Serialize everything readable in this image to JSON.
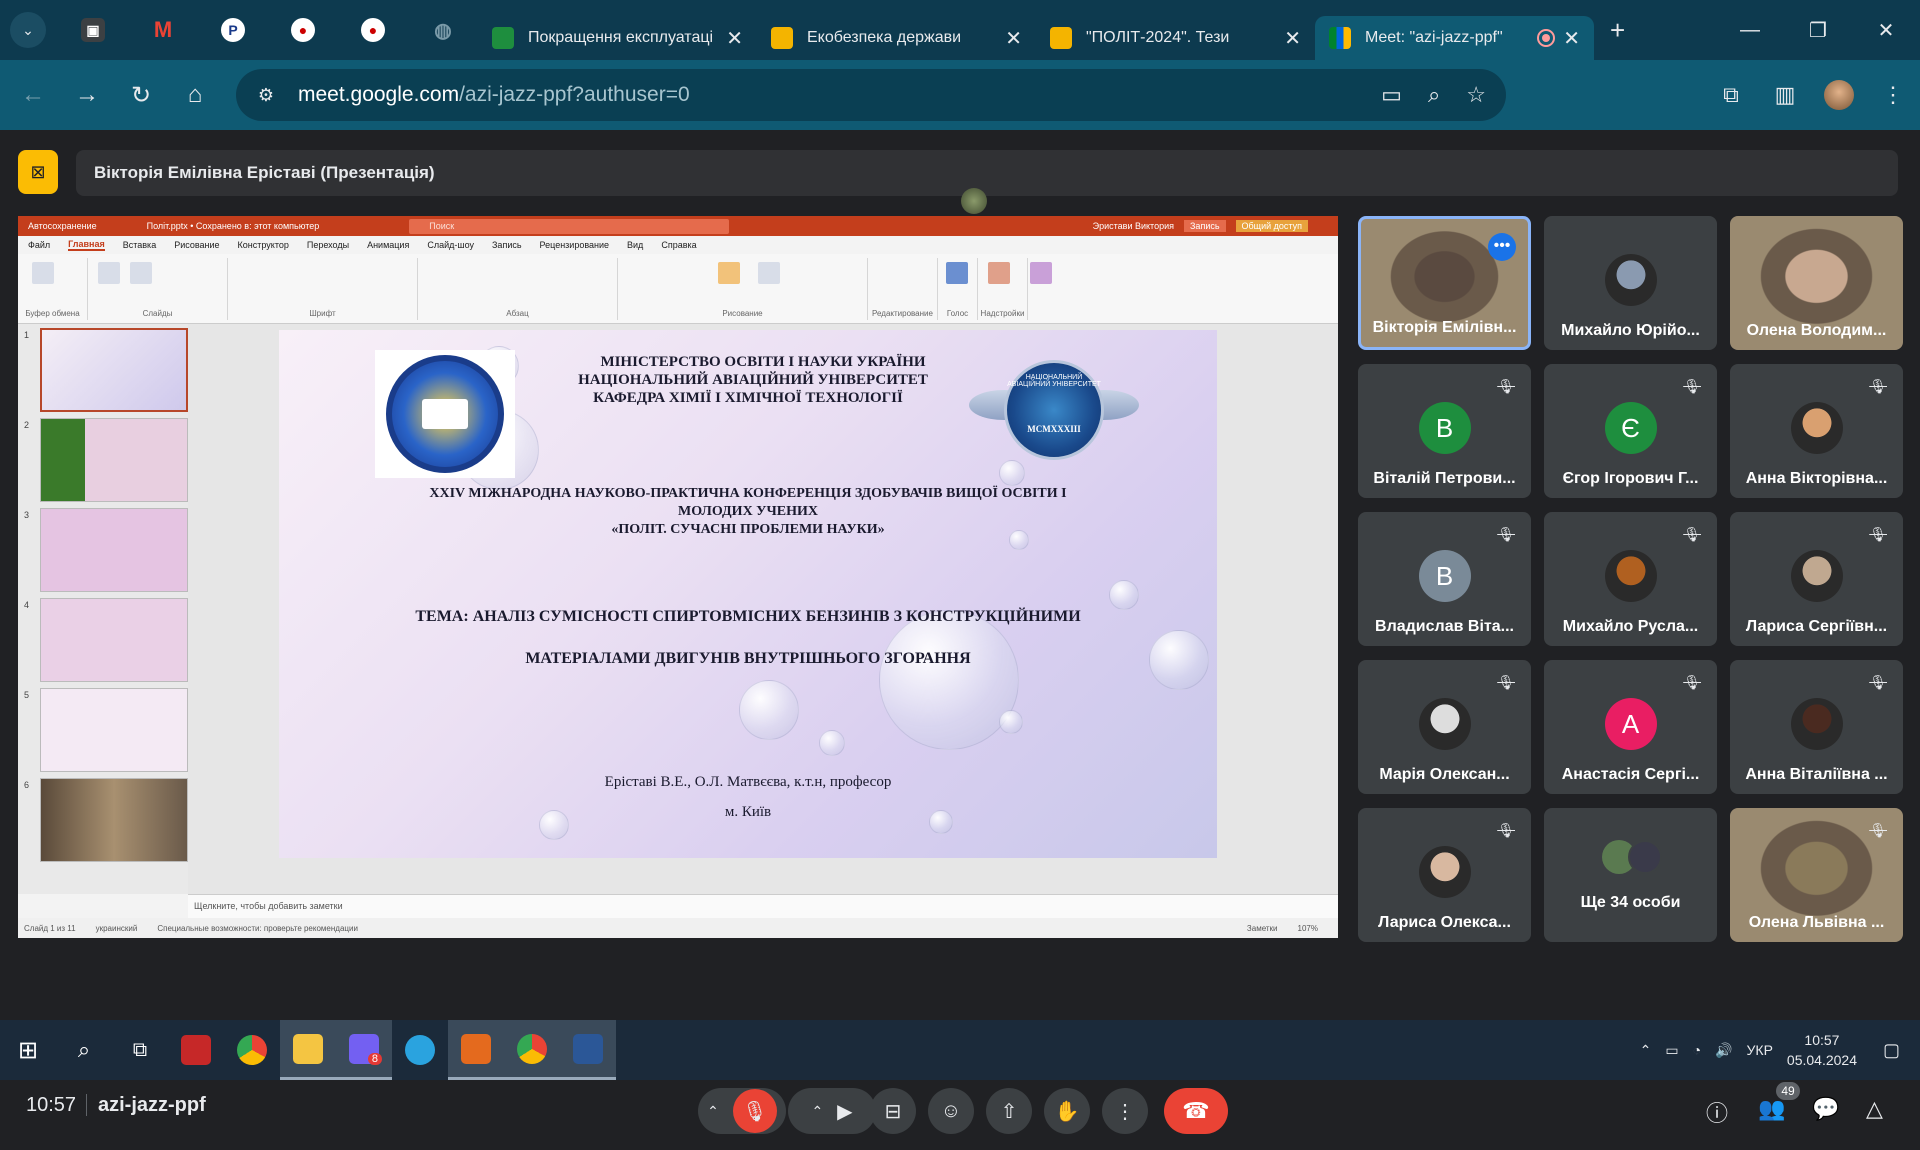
{
  "browser": {
    "tabs": [
      {
        "title": "Покращення експлуатаці",
        "favicon": "slides-icon",
        "color": "#f4b400"
      },
      {
        "title": "Екобезпека держави",
        "favicon": "slides-icon",
        "color": "#f4b400"
      },
      {
        "title": "\"ПОЛІТ-2024\". Тези",
        "favicon": "slides-icon",
        "color": "#f4b400"
      },
      {
        "title": "Meet: \"azi-jazz-ppf\"",
        "favicon": "meet-icon",
        "color": "#34a853"
      }
    ],
    "url_host": "meet.google.com",
    "url_path": "/azi-jazz-ppf?authuser=0"
  },
  "meet": {
    "presenter_banner": "Вікторія Емілівна Еріставі (Презентація)",
    "time": "10:57",
    "meeting_code": "azi-jazz-ppf",
    "participant_count": "49",
    "participants": [
      {
        "name": "Вікторія Емілівн...",
        "initial": "",
        "color": "#5a4a40",
        "type": "photo",
        "muted": false,
        "active": true
      },
      {
        "name": "Михайло Юрійо...",
        "initial": "",
        "color": "#8a9ab0",
        "type": "avatar-photo",
        "muted": false,
        "active": false
      },
      {
        "name": "Олена Володим...",
        "initial": "",
        "color": "#c8a890",
        "type": "photo",
        "muted": false,
        "active": false
      },
      {
        "name": "Віталій Петрови...",
        "initial": "В",
        "color": "#1e8e3e",
        "type": "letter",
        "muted": true,
        "active": false
      },
      {
        "name": "Єгор Ігорович Г...",
        "initial": "Є",
        "color": "#1e8e3e",
        "type": "letter",
        "muted": true,
        "active": false
      },
      {
        "name": "Анна Вікторівна...",
        "initial": "",
        "color": "#d9a070",
        "type": "avatar-photo",
        "muted": true,
        "active": false
      },
      {
        "name": "Владислав Віта...",
        "initial": "В",
        "color": "#7a8a98",
        "type": "letter",
        "muted": true,
        "active": false
      },
      {
        "name": "Михайло Русла...",
        "initial": "",
        "color": "#b06020",
        "type": "avatar-photo",
        "muted": true,
        "active": false
      },
      {
        "name": "Лариса Сергіївн...",
        "initial": "",
        "color": "#c0a890",
        "type": "avatar-photo",
        "muted": true,
        "active": false
      },
      {
        "name": "Марія Олексан...",
        "initial": "",
        "color": "#ddd",
        "type": "avatar-photo",
        "muted": true,
        "active": false
      },
      {
        "name": "Анастасія Сергі...",
        "initial": "А",
        "color": "#e91e63",
        "type": "letter",
        "muted": true,
        "active": false
      },
      {
        "name": "Анна Віталіївна ...",
        "initial": "",
        "color": "#4a2a20",
        "type": "avatar-photo",
        "muted": true,
        "active": false
      },
      {
        "name": "Лариса Олекса...",
        "initial": "",
        "color": "#d8b8a0",
        "type": "avatar-photo",
        "muted": true,
        "active": false
      },
      {
        "name": "Ще 34 особи",
        "initial": "",
        "color": "#5a7a50",
        "type": "group",
        "muted": false,
        "active": false
      },
      {
        "name": "Олена Львівна ...",
        "initial": "",
        "color": "#8a7a5a",
        "type": "photo",
        "muted": true,
        "active": false
      }
    ]
  },
  "powerpoint": {
    "autosave": "Автосохранение",
    "doc_title": "Політ.pptx • Сохранено в: этот компьютер",
    "search": "Поиск",
    "user": "Эристави Виктория",
    "record_btn": "Запись",
    "share_btn": "Общий доступ",
    "menu": [
      "Файл",
      "Главная",
      "Вставка",
      "Рисование",
      "Конструктор",
      "Переходы",
      "Анимация",
      "Слайд-шоу",
      "Запись",
      "Рецензирование",
      "Вид",
      "Справка"
    ],
    "ribbon_groups": [
      "Буфер обмена",
      "Слайды",
      "Шрифт",
      "Абзац",
      "Рисование",
      "Редактирование",
      "Голос",
      "Надстройки"
    ],
    "notes_placeholder": "Щелкните, чтобы добавить заметки",
    "status": [
      "Слайд 1 из 11",
      "украинский",
      "Специальные возможности: проверьте рекомендации"
    ],
    "status_right": [
      "Заметки",
      "107%"
    ],
    "thumbnails": [
      "1",
      "2",
      "3",
      "4",
      "5",
      "6"
    ],
    "slide": {
      "ministry_1": "МІНІСТЕРСТВО ОСВІТИ І НАУКИ УКРАЇНИ",
      "ministry_2": "НАЦІОНАЛЬНИЙ АВІАЦІЙНИЙ УНІВЕРСИТЕТ",
      "ministry_3": "КАФЕДРА ХІМІЇ І ХІМІЧНОЇ ТЕХНОЛОГІЇ",
      "conf_1": "XXIV МІЖНАРОДНА НАУКОВО-ПРАКТИЧНА КОНФЕРЕНЦІЯ ЗДОБУВАЧІВ ВИЩОЇ ОСВІТИ І",
      "conf_2": "МОЛОДИХ УЧЕНИХ",
      "conf_3": "«ПОЛІТ. СУЧАСНІ ПРОБЛЕМИ НАУКИ»",
      "topic_1": "ТЕМА: АНАЛІЗ СУМІСНОСТІ СПИРТОВМІСНИХ БЕНЗИНІВ З КОНСТРУКЦІЙНИМИ",
      "topic_2": "МАТЕРІАЛАМИ ДВИГУНІВ ВНУТРІШНЬОГО ЗГОРАННЯ",
      "authors": "Еріставі В.Е., О.Л. Матвєєва, к.т.н, професор",
      "city": "м. Київ",
      "logo_right_text": "НАЦІОНАЛЬНИЙ АВІАЦІЙНИЙ УНІВЕРСИТЕТ",
      "logo_right_year": "MCMXXXIII"
    }
  },
  "taskbar": {
    "lang": "УКР",
    "time": "10:57",
    "date": "05.04.2024",
    "viber_badge": "8"
  }
}
